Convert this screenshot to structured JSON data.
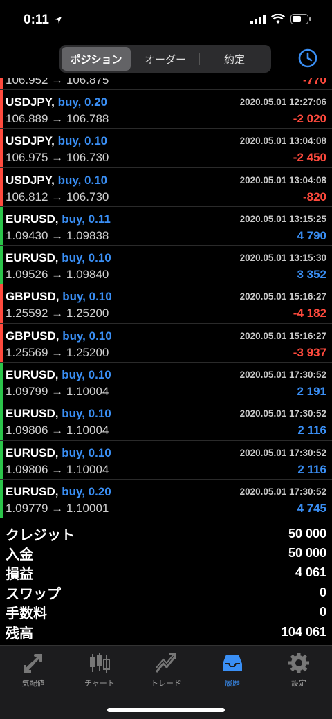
{
  "status": {
    "time": "0:11"
  },
  "header": {
    "tabs": [
      {
        "label": "ポジション",
        "active": true
      },
      {
        "label": "オーダー",
        "active": false
      },
      {
        "label": "約定",
        "active": false
      }
    ],
    "history_icon": "clock-icon"
  },
  "colors": {
    "blue": "#3a8ff5",
    "red": "#ff4a3d",
    "green": "#2bc44a"
  },
  "partial_row": {
    "prices": "106.952 → 106.875",
    "profit": "-770",
    "sign": "neg",
    "bar": "#ff4a3d"
  },
  "deals": [
    {
      "symbol": "USDJPY,",
      "side": "buy, 0.20",
      "time": "2020.05.01 12:27:06",
      "prices": "106.889 → 106.788",
      "profit": "-2 020",
      "sign": "neg",
      "bar": "#ff4a3d"
    },
    {
      "symbol": "USDJPY,",
      "side": "buy, 0.10",
      "time": "2020.05.01 13:04:08",
      "prices": "106.975 → 106.730",
      "profit": "-2 450",
      "sign": "neg",
      "bar": "#ff4a3d"
    },
    {
      "symbol": "USDJPY,",
      "side": "buy, 0.10",
      "time": "2020.05.01 13:04:08",
      "prices": "106.812 → 106.730",
      "profit": "-820",
      "sign": "neg",
      "bar": "#ff4a3d"
    },
    {
      "symbol": "EURUSD,",
      "side": "buy, 0.11",
      "time": "2020.05.01 13:15:25",
      "prices": "1.09430 → 1.09838",
      "profit": "4 790",
      "sign": "pos",
      "bar": "#2bc44a"
    },
    {
      "symbol": "EURUSD,",
      "side": "buy, 0.10",
      "time": "2020.05.01 13:15:30",
      "prices": "1.09526 → 1.09840",
      "profit": "3 352",
      "sign": "pos",
      "bar": "#2bc44a"
    },
    {
      "symbol": "GBPUSD,",
      "side": "buy, 0.10",
      "time": "2020.05.01 15:16:27",
      "prices": "1.25592 → 1.25200",
      "profit": "-4 182",
      "sign": "neg",
      "bar": "#ff4a3d"
    },
    {
      "symbol": "GBPUSD,",
      "side": "buy, 0.10",
      "time": "2020.05.01 15:16:27",
      "prices": "1.25569 → 1.25200",
      "profit": "-3 937",
      "sign": "neg",
      "bar": "#ff4a3d"
    },
    {
      "symbol": "EURUSD,",
      "side": "buy, 0.10",
      "time": "2020.05.01 17:30:52",
      "prices": "1.09799 → 1.10004",
      "profit": "2 191",
      "sign": "pos",
      "bar": "#2bc44a"
    },
    {
      "symbol": "EURUSD,",
      "side": "buy, 0.10",
      "time": "2020.05.01 17:30:52",
      "prices": "1.09806 → 1.10004",
      "profit": "2 116",
      "sign": "pos",
      "bar": "#2bc44a"
    },
    {
      "symbol": "EURUSD,",
      "side": "buy, 0.10",
      "time": "2020.05.01 17:30:52",
      "prices": "1.09806 → 1.10004",
      "profit": "2 116",
      "sign": "pos",
      "bar": "#2bc44a"
    },
    {
      "symbol": "EURUSD,",
      "side": "buy, 0.20",
      "time": "2020.05.01 17:30:52",
      "prices": "1.09779 → 1.10001",
      "profit": "4 745",
      "sign": "pos",
      "bar": "#2bc44a"
    }
  ],
  "summary": [
    {
      "label": "クレジット",
      "value": "50 000"
    },
    {
      "label": "入金",
      "value": "50 000"
    },
    {
      "label": "損益",
      "value": "4 061"
    },
    {
      "label": "スワップ",
      "value": "0"
    },
    {
      "label": "手数料",
      "value": "0"
    },
    {
      "label": "残高",
      "value": "104 061"
    }
  ],
  "tabbar": [
    {
      "label": "気配値",
      "icon": "quotes-icon",
      "active": false
    },
    {
      "label": "チャート",
      "icon": "chart-icon",
      "active": false
    },
    {
      "label": "トレード",
      "icon": "trade-icon",
      "active": false
    },
    {
      "label": "履歴",
      "icon": "history-icon",
      "active": true
    },
    {
      "label": "設定",
      "icon": "settings-icon",
      "active": false
    }
  ]
}
